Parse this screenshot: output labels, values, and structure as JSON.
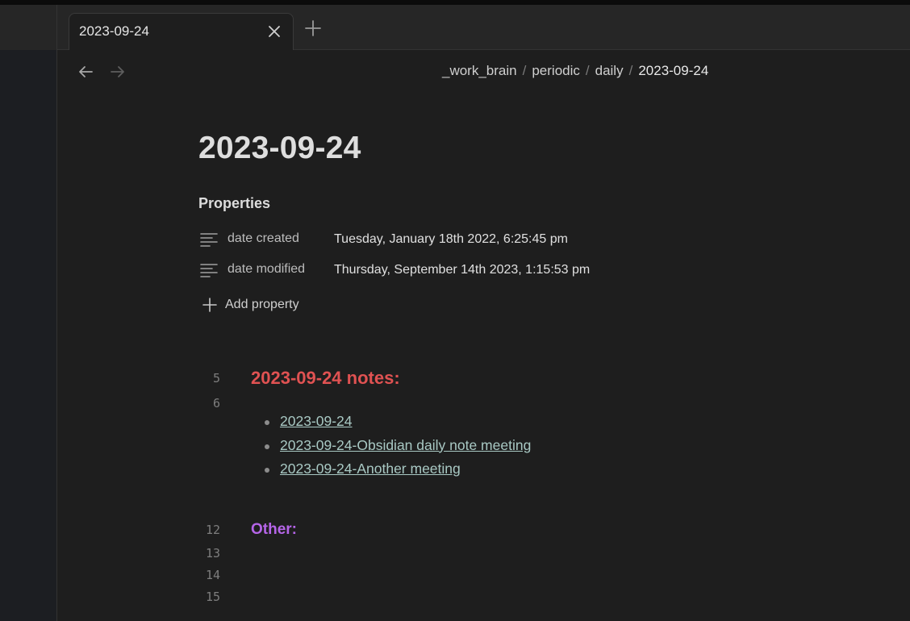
{
  "tabs": [
    {
      "title": "2023-09-24"
    }
  ],
  "breadcrumb": [
    "_work_brain",
    "periodic",
    "daily",
    "2023-09-24"
  ],
  "note": {
    "title": "2023-09-24",
    "properties_heading": "Properties",
    "properties": [
      {
        "key": "date created",
        "value": "Tuesday, January 18th 2022, 6:25:45 pm"
      },
      {
        "key": "date modified",
        "value": "Thursday, September 14th 2023, 1:15:53 pm"
      }
    ],
    "add_property_label": "Add property",
    "line_numbers": [
      "5",
      "6",
      "12",
      "13",
      "14",
      "15"
    ],
    "section1_heading": "2023-09-24 notes:",
    "links": [
      "2023-09-24",
      "2023-09-24-Obsidian daily note meeting",
      "2023-09-24-Another meeting"
    ],
    "section2_heading": "Other:"
  },
  "icons": {
    "tab_close": "close-icon",
    "new_tab": "plus-icon",
    "back": "arrow-left-icon",
    "forward": "arrow-right-icon",
    "property_type": "text-lines-icon",
    "add_property": "plus-icon"
  },
  "colors": {
    "background": "#1e1e1e",
    "heading_red": "#e05252",
    "heading_purple": "#b565e8",
    "link": "#a9c9c4"
  }
}
